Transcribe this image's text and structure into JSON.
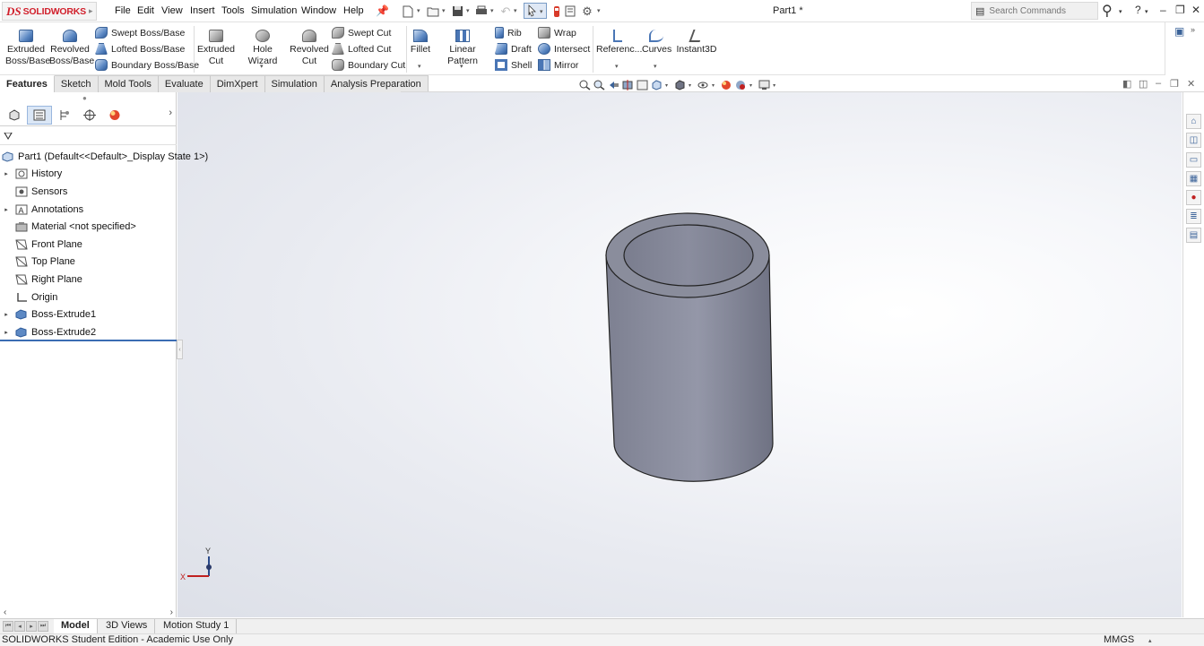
{
  "app": {
    "logo_prefix": "DS",
    "logo_text": "SOLIDWORKS",
    "document_title": "Part1 *"
  },
  "menu": {
    "items": [
      "File",
      "Edit",
      "View",
      "Insert",
      "Tools",
      "Simulation",
      "Window",
      "Help"
    ]
  },
  "search": {
    "placeholder": "Search Commands"
  },
  "ribbon": {
    "extruded_boss": "Extruded Boss/Base",
    "revolved_boss": "Revolved Boss/Base",
    "swept_boss": "Swept Boss/Base",
    "lofted_boss": "Lofted Boss/Base",
    "boundary_boss": "Boundary Boss/Base",
    "extruded_cut": "Extruded Cut",
    "hole_wizard": "Hole Wizard",
    "revolved_cut": "Revolved Cut",
    "swept_cut": "Swept Cut",
    "lofted_cut": "Lofted Cut",
    "boundary_cut": "Boundary Cut",
    "fillet": "Fillet",
    "linear_pattern": "Linear Pattern",
    "rib": "Rib",
    "draft": "Draft",
    "shell": "Shell",
    "wrap": "Wrap",
    "intersect": "Intersect",
    "mirror": "Mirror",
    "reference": "Referenc...",
    "curves": "Curves",
    "instant3d": "Instant3D"
  },
  "tabs": {
    "items": [
      "Features",
      "Sketch",
      "Mold Tools",
      "Evaluate",
      "DimXpert",
      "Simulation",
      "Analysis Preparation"
    ],
    "active": "Features"
  },
  "feature_tree": {
    "root": "Part1  (Default<<Default>_Display State 1>)",
    "items": [
      {
        "label": "History",
        "expandable": true
      },
      {
        "label": "Sensors",
        "expandable": false
      },
      {
        "label": "Annotations",
        "expandable": true
      },
      {
        "label": "Material <not specified>",
        "expandable": false
      },
      {
        "label": "Front Plane",
        "expandable": false
      },
      {
        "label": "Top Plane",
        "expandable": false
      },
      {
        "label": "Right Plane",
        "expandable": false
      },
      {
        "label": "Origin",
        "expandable": false
      },
      {
        "label": "Boss-Extrude1",
        "expandable": true
      },
      {
        "label": "Boss-Extrude2",
        "expandable": true
      }
    ]
  },
  "triad": {
    "x_label": "X",
    "y_label": "Y"
  },
  "bottom_tabs": {
    "items": [
      "Model",
      "3D Views",
      "Motion Study 1"
    ],
    "active": "Model"
  },
  "status": {
    "text": "SOLIDWORKS Student Edition - Academic Use Only",
    "units": "MMGS"
  },
  "colors": {
    "brand_red": "#d11f2b",
    "part_body": "#8a8d9c",
    "selection_blue": "#3b6cb3"
  }
}
